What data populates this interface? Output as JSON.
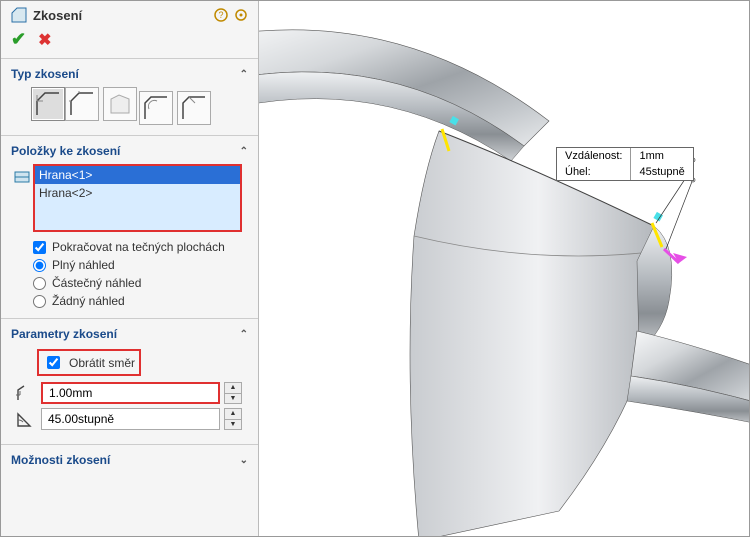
{
  "panel": {
    "title": "Zkosení",
    "sections": {
      "type": {
        "title": "Typ zkosení"
      },
      "items": {
        "title": "Položky ke zkosení",
        "list": [
          "Hrana<1>",
          "Hrana<2>"
        ],
        "tangent": "Pokračovat na tečných plochách",
        "preview_full": "Plný náhled",
        "preview_partial": "Částečný náhled",
        "preview_none": "Žádný náhled"
      },
      "params": {
        "title": "Parametry zkosení",
        "reverse": "Obrátit směr",
        "distance": "1.00mm",
        "angle": "45.00stupně"
      },
      "options": {
        "title": "Možnosti zkosení"
      }
    }
  },
  "callout": {
    "dist_label": "Vzdálenost:",
    "dist_value": "1mm",
    "angle_label": "Úhel:",
    "angle_value": "45stupně"
  }
}
